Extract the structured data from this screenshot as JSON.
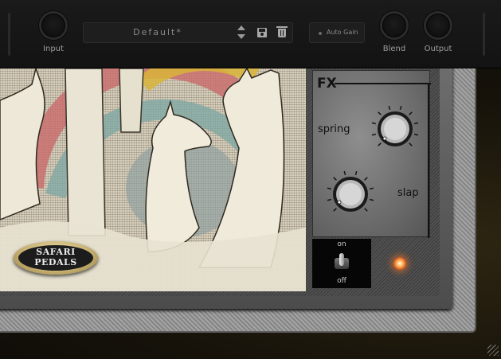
{
  "header": {
    "input_label": "Input",
    "preset_name": "Default*",
    "auto_gain_label": "Auto Gain",
    "blend_label": "Blend",
    "output_label": "Output"
  },
  "logo": {
    "line1": "SAFARI",
    "line2": "PEDALS"
  },
  "fx": {
    "title": "FX",
    "spring_label": "spring",
    "slap_label": "slap",
    "toggle_on": "on",
    "toggle_off": "off"
  },
  "colors": {
    "top_bar": "#161616",
    "led": "#ff8a3a",
    "fx_plate": "#7a7a7a"
  },
  "icons": {
    "preset_step": "chevron-up-down-icon",
    "save": "save-icon",
    "delete": "trash-icon",
    "resize": "resize-grip-icon"
  }
}
